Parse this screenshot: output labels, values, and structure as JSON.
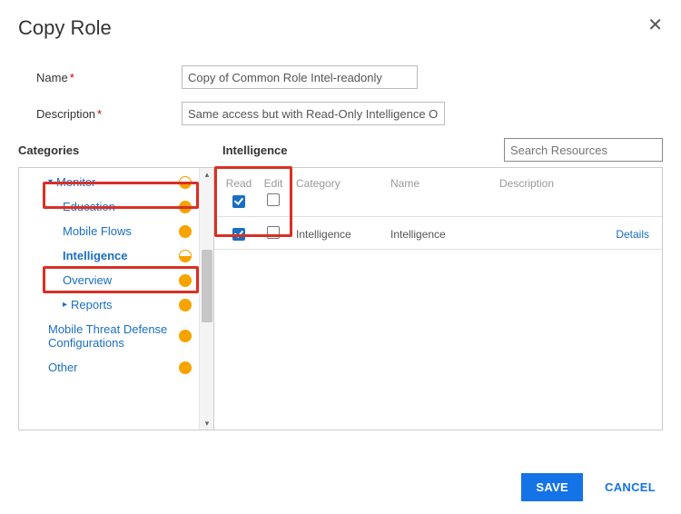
{
  "dialog": {
    "title": "Copy Role"
  },
  "form": {
    "name_label": "Name",
    "name_value": "Copy of Common Role Intel-readonly",
    "desc_label": "Description",
    "desc_value": "Same access but with Read-Only Intelligence Opt-In"
  },
  "sections": {
    "categories": "Categories",
    "detail_title": "Intelligence",
    "search_placeholder": "Search Resources"
  },
  "categories": {
    "monitor": "Monitor",
    "education": "Education",
    "mobile_flows": "Mobile Flows",
    "intelligence": "Intelligence",
    "overview": "Overview",
    "reports": "Reports",
    "mtd": "Mobile Threat Defense Configurations",
    "other": "Other"
  },
  "perm_columns": {
    "read": "Read",
    "edit": "Edit",
    "category": "Category",
    "name": "Name",
    "description": "Description"
  },
  "perm_row": {
    "category": "Intelligence",
    "name": "Intelligence",
    "description": "",
    "link": "Details"
  },
  "footer": {
    "save": "SAVE",
    "cancel": "CANCEL"
  }
}
